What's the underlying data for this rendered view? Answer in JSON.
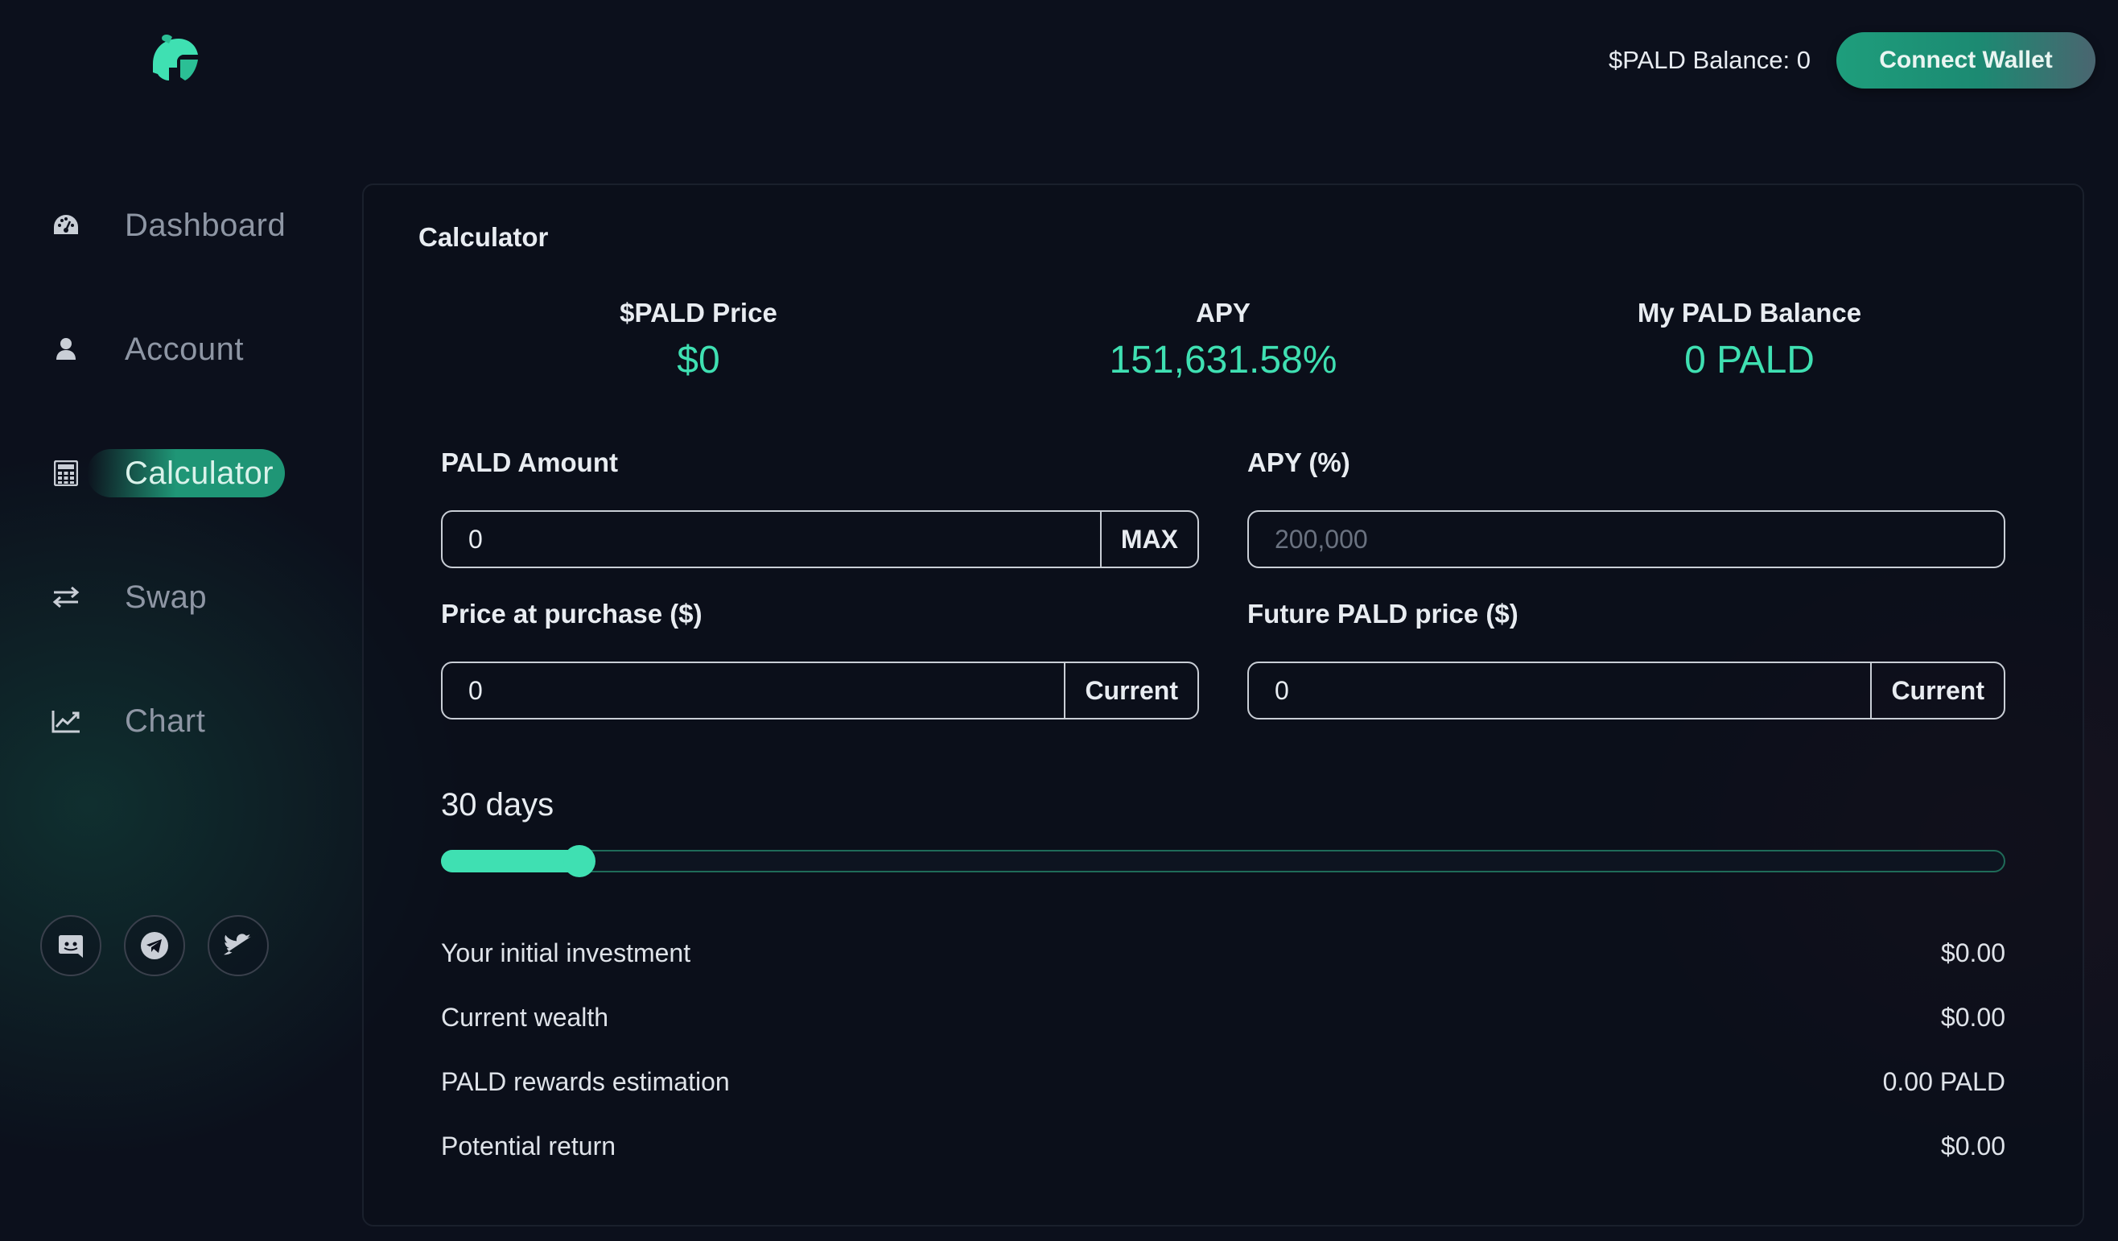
{
  "header": {
    "balance_text": "$PALD Balance: 0",
    "connect_label": "Connect Wallet"
  },
  "sidebar": {
    "items": [
      {
        "label": "Dashboard",
        "icon": "dashboard-gauge-icon"
      },
      {
        "label": "Account",
        "icon": "user-icon"
      },
      {
        "label": "Calculator",
        "icon": "calculator-icon",
        "active": true
      },
      {
        "label": "Swap",
        "icon": "swap-arrows-icon"
      },
      {
        "label": "Chart",
        "icon": "chart-line-icon"
      }
    ],
    "socials": [
      "discord-icon",
      "telegram-icon",
      "twitter-icon"
    ]
  },
  "calculator": {
    "title": "Calculator",
    "stats": [
      {
        "label": "$PALD Price",
        "value": "$0"
      },
      {
        "label": "APY",
        "value": "151,631.58%"
      },
      {
        "label": "My PALD Balance",
        "value": "0 PALD"
      }
    ],
    "fields": {
      "pald_amount": {
        "label": "PALD Amount",
        "value": "0",
        "button": "MAX"
      },
      "apy": {
        "label": "APY (%)",
        "placeholder": "200,000"
      },
      "purchase_price": {
        "label": "Price at purchase ($)",
        "value": "0",
        "button": "Current"
      },
      "future_price": {
        "label": "Future PALD price ($)",
        "value": "0",
        "button": "Current"
      }
    },
    "days_label": "30 days",
    "slider": {
      "value": 30,
      "min": 1,
      "max": 365
    },
    "results": [
      {
        "label": "Your initial investment",
        "value": "$0.00"
      },
      {
        "label": "Current wealth",
        "value": "$0.00"
      },
      {
        "label": "PALD rewards estimation",
        "value": "0.00 PALD"
      },
      {
        "label": "Potential return",
        "value": "$0.00"
      }
    ]
  },
  "colors": {
    "accent": "#3fe0b2",
    "button": "#1f9676",
    "background": "#0c101c"
  }
}
